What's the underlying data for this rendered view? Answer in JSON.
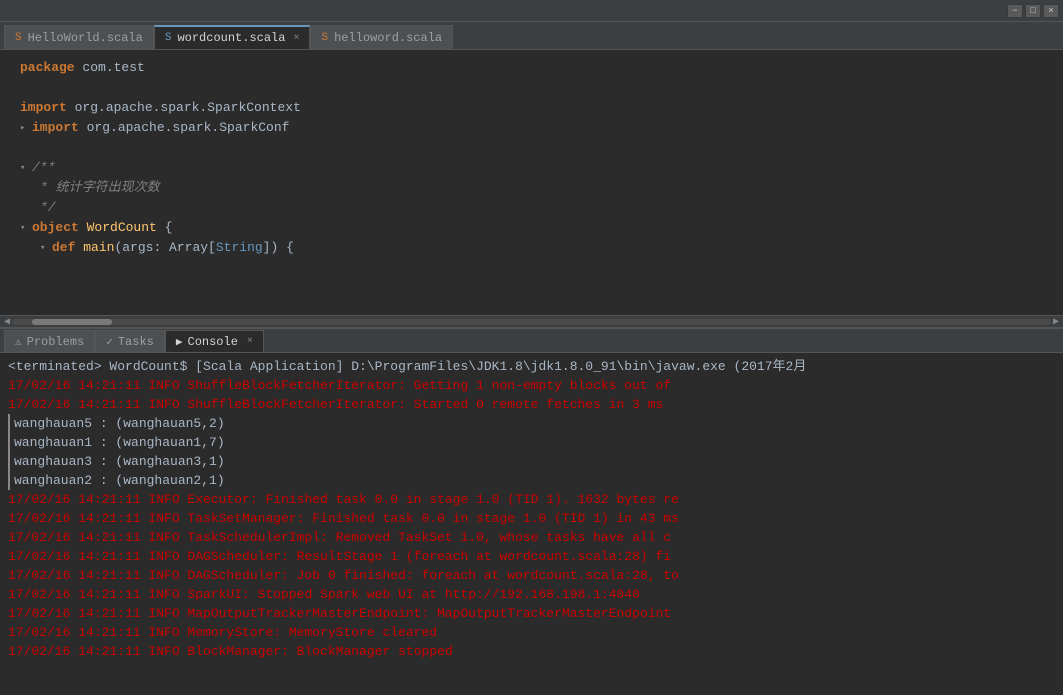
{
  "titlebar": {
    "min_label": "−",
    "max_label": "□",
    "close_label": "×"
  },
  "tabs": [
    {
      "id": "hello-world",
      "label": "HelloWorld.scala",
      "active": false,
      "closable": false
    },
    {
      "id": "wordcount",
      "label": "wordcount.scala",
      "active": true,
      "closable": true
    },
    {
      "id": "helloword",
      "label": "helloword.scala",
      "active": false,
      "closable": false
    }
  ],
  "editor": {
    "lines": [
      {
        "indent": 1,
        "content": "package com.test",
        "type": "code"
      },
      {
        "indent": 0,
        "content": "",
        "type": "blank"
      },
      {
        "indent": 1,
        "content": "import org.apache.spark.SparkContext",
        "type": "import"
      },
      {
        "indent": 1,
        "content": "import org.apache.spark.SparkConf",
        "type": "import",
        "fold": true
      },
      {
        "indent": 0,
        "content": "",
        "type": "blank"
      },
      {
        "indent": 1,
        "content": "/**",
        "type": "comment",
        "fold": true
      },
      {
        "indent": 2,
        "content": "* 统计字符出现次数",
        "type": "comment"
      },
      {
        "indent": 2,
        "content": "*/",
        "type": "comment"
      },
      {
        "indent": 1,
        "content": "object WordCount {",
        "type": "code",
        "fold": true
      },
      {
        "indent": 2,
        "content": "def main(args: Array[String]) {",
        "type": "code",
        "fold": true
      }
    ]
  },
  "panel_tabs": [
    {
      "id": "problems",
      "label": "Problems",
      "icon": "⚠",
      "active": false
    },
    {
      "id": "tasks",
      "label": "Tasks",
      "icon": "✓",
      "active": false
    },
    {
      "id": "console",
      "label": "Console",
      "icon": "▶",
      "active": true,
      "closable": true
    }
  ],
  "console": {
    "terminated_line": "<terminated> WordCount$ [Scala Application] D:\\ProgramFiles\\JDK1.8\\jdk1.8.0_91\\bin\\javaw.exe (2017年2月",
    "lines": [
      {
        "type": "info",
        "text": "17/02/16 14:21:11 INFO ShuffleBlockFetcherIterator: Getting 1 non-empty blocks out of"
      },
      {
        "type": "info",
        "text": "17/02/16 14:21:11 INFO ShuffleBlockFetcherIterator: Started 0 remote fetches in 3 ms"
      },
      {
        "type": "normal",
        "text": "wanghauan5 : (wanghauan5,2)"
      },
      {
        "type": "normal",
        "text": "wanghauan1 : (wanghauan1,7)"
      },
      {
        "type": "normal",
        "text": "wanghauan3 : (wanghauan3,1)"
      },
      {
        "type": "normal",
        "text": "wanghauan2 : (wanghauan2,1)"
      },
      {
        "type": "info",
        "text": "17/02/16 14:21:11 INFO Executor: Finished task 0.0 in stage 1.0 (TID 1). 1632 bytes re"
      },
      {
        "type": "info",
        "text": "17/02/16 14:21:11 INFO TaskSetManager: Finished task 0.0 in stage 1.0 (TID 1) in 43 ms"
      },
      {
        "type": "info",
        "text": "17/02/16 14:21:11 INFO TaskSchedulerImpl: Removed TaskSet 1.0, whose tasks have all c"
      },
      {
        "type": "info",
        "text": "17/02/16 14:21:11 INFO DAGScheduler: ResultStage 1 (foreach at wordcount.scala:28) fi"
      },
      {
        "type": "info",
        "text": "17/02/16 14:21:11 INFO DAGScheduler: Job 0 finished: foreach at wordcount.scala:28, to"
      },
      {
        "type": "info",
        "text": "17/02/16 14:21:11 INFO SparkUI: Stopped Spark web UI at http://192.168.198.1:4040"
      },
      {
        "type": "info",
        "text": "17/02/16 14:21:11 INFO MapOutputTrackerMasterEndpoint: MapOutputTrackerMasterEndpoint"
      },
      {
        "type": "info",
        "text": "17/02/16 14:21:11 INFO MemoryStore: MemoryStore cleared"
      },
      {
        "type": "info",
        "text": "17/02/16 14:21:11 INFO BlockManager: BlockManager stopped"
      }
    ]
  }
}
